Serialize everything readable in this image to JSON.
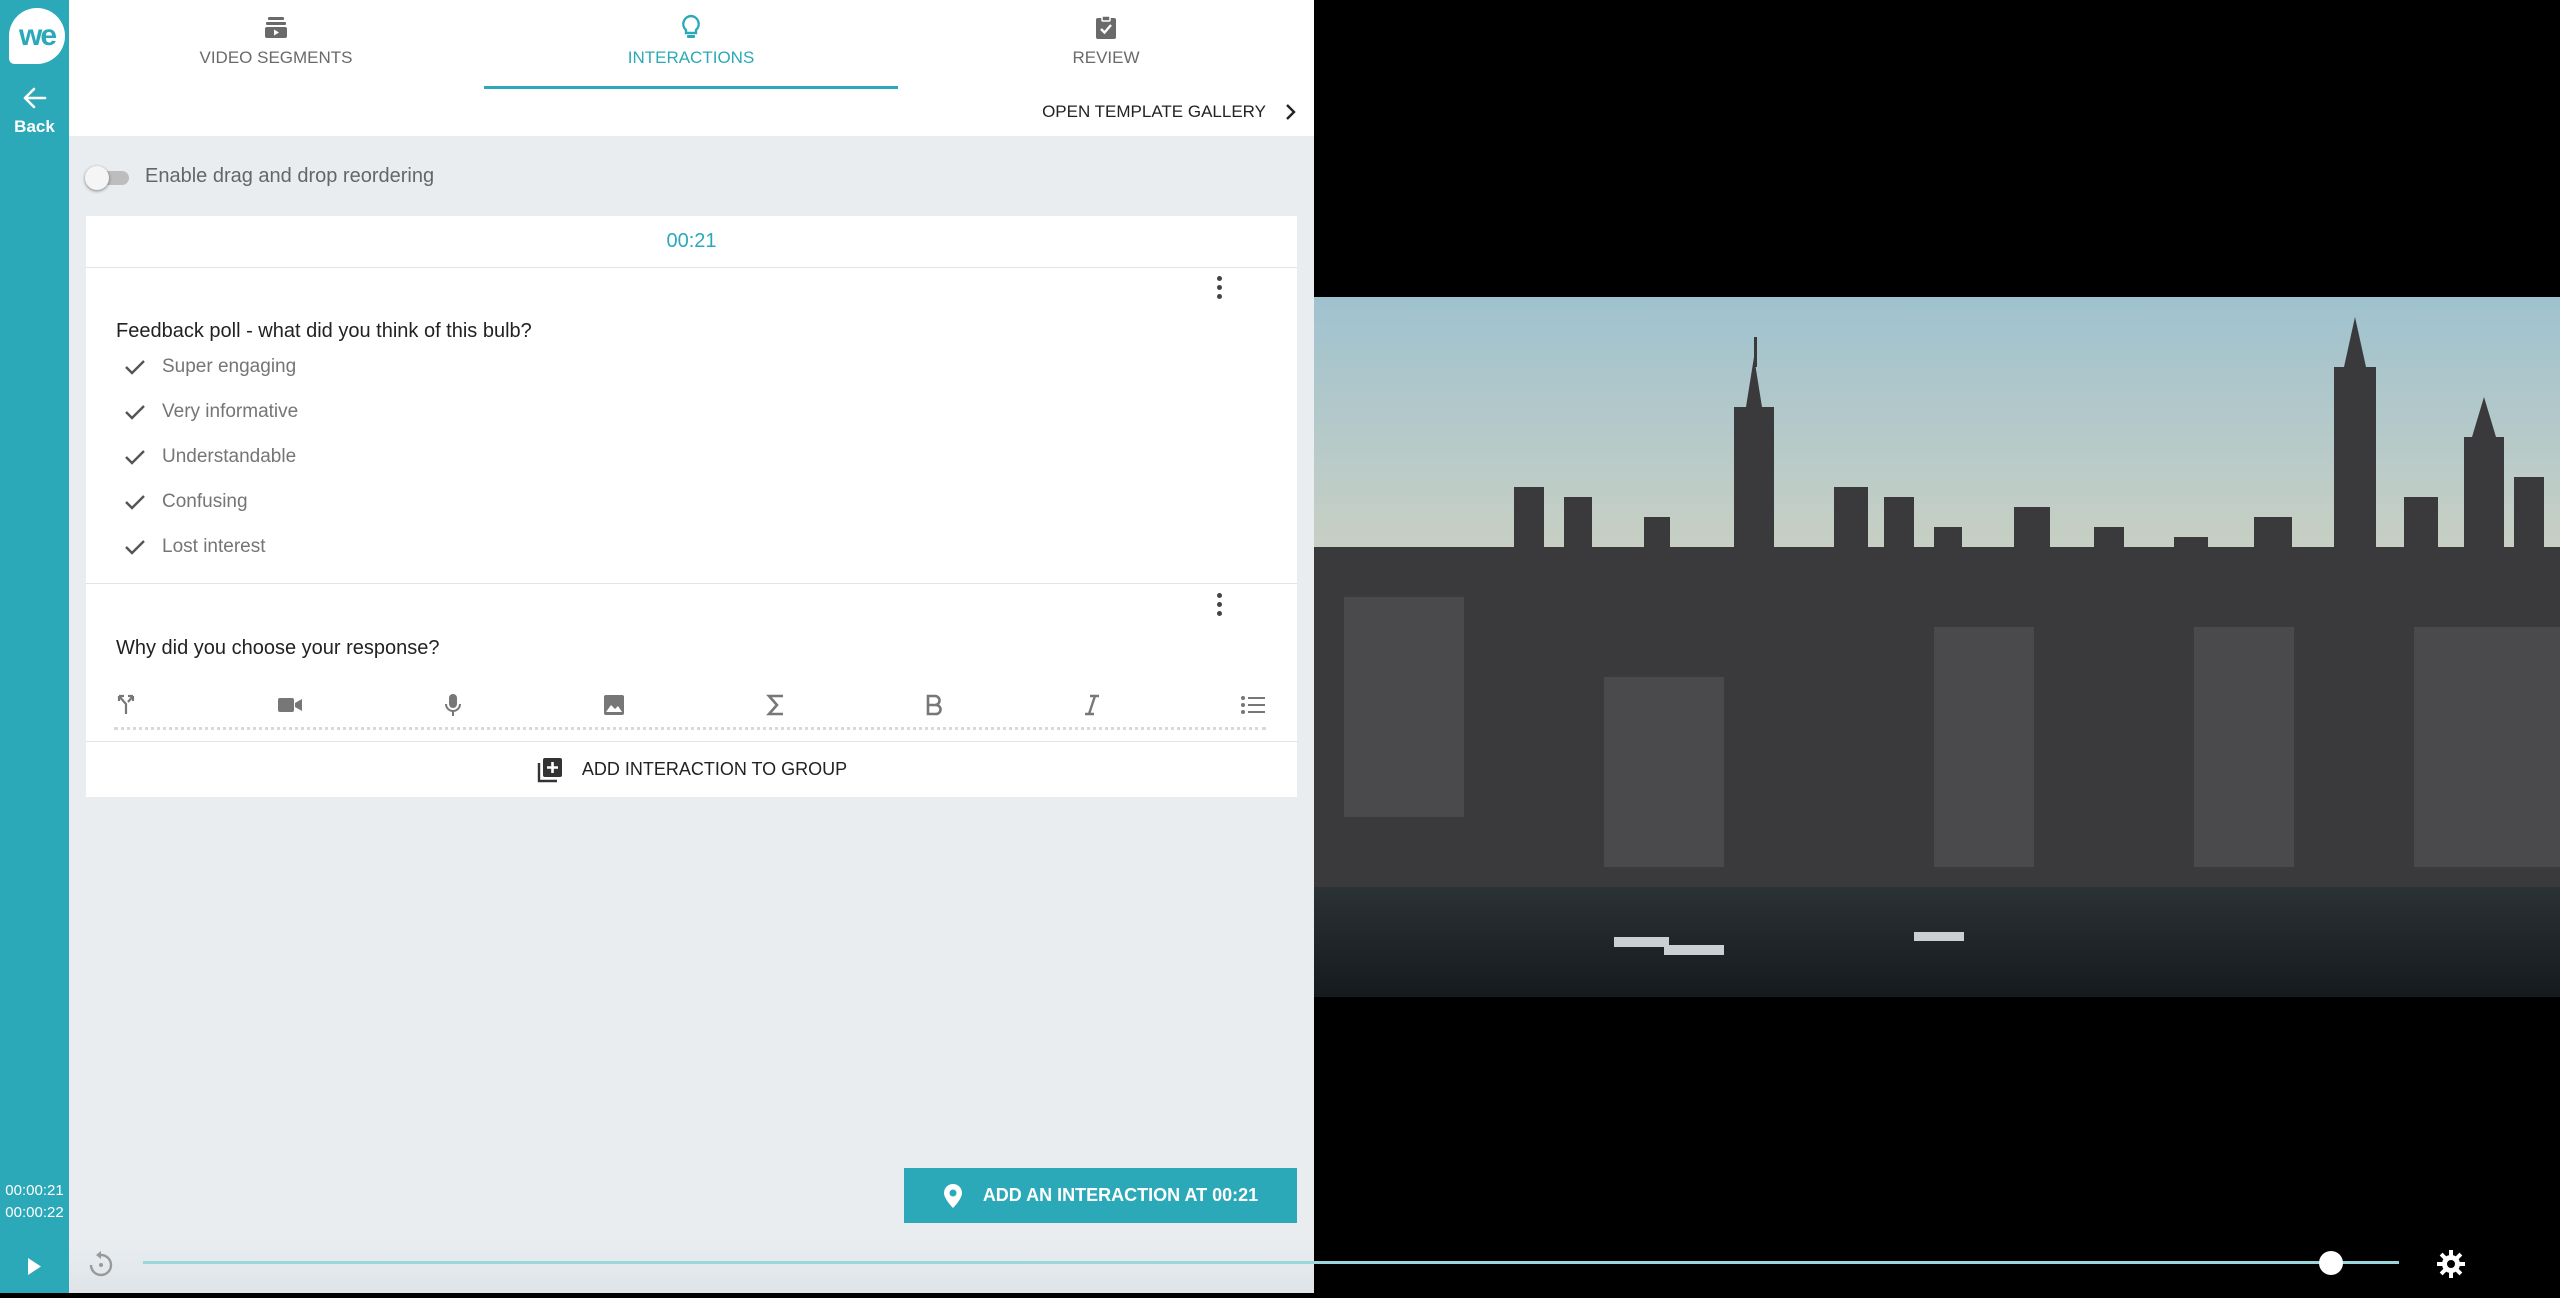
{
  "app": {
    "logo_text": "we",
    "back_label": "Back"
  },
  "time": {
    "current": "00:00:21",
    "total": "00:00:22"
  },
  "tabs": [
    {
      "label": "VIDEO SEGMENTS",
      "icon": "segments-icon"
    },
    {
      "label": "INTERACTIONS",
      "icon": "lightbulb-icon",
      "active": true
    },
    {
      "label": "REVIEW",
      "icon": "clipboard-check-icon"
    }
  ],
  "gallery": {
    "label": "OPEN TEMPLATE GALLERY"
  },
  "reorder": {
    "label": "Enable drag and drop reordering",
    "enabled": false
  },
  "group": {
    "timestamp": "00:21",
    "poll": {
      "question": "Feedback poll - what did you think of this bulb?",
      "options": [
        "Super engaging",
        "Very informative",
        "Understandable",
        "Confusing",
        "Lost interest"
      ]
    },
    "open_question": {
      "question": "Why did you choose your response?",
      "toolbar": [
        "branch-icon",
        "video-icon",
        "mic-icon",
        "image-icon",
        "sigma-icon",
        "bold-icon",
        "italic-icon",
        "list-icon"
      ]
    },
    "add_label": "ADD INTERACTION TO GROUP"
  },
  "add_interaction": {
    "label": "ADD AN INTERACTION AT 00:21"
  },
  "player": {
    "progress_fraction": 0.97
  },
  "colors": {
    "accent": "#2ba9b9",
    "panel_bg": "#e9edf0"
  }
}
